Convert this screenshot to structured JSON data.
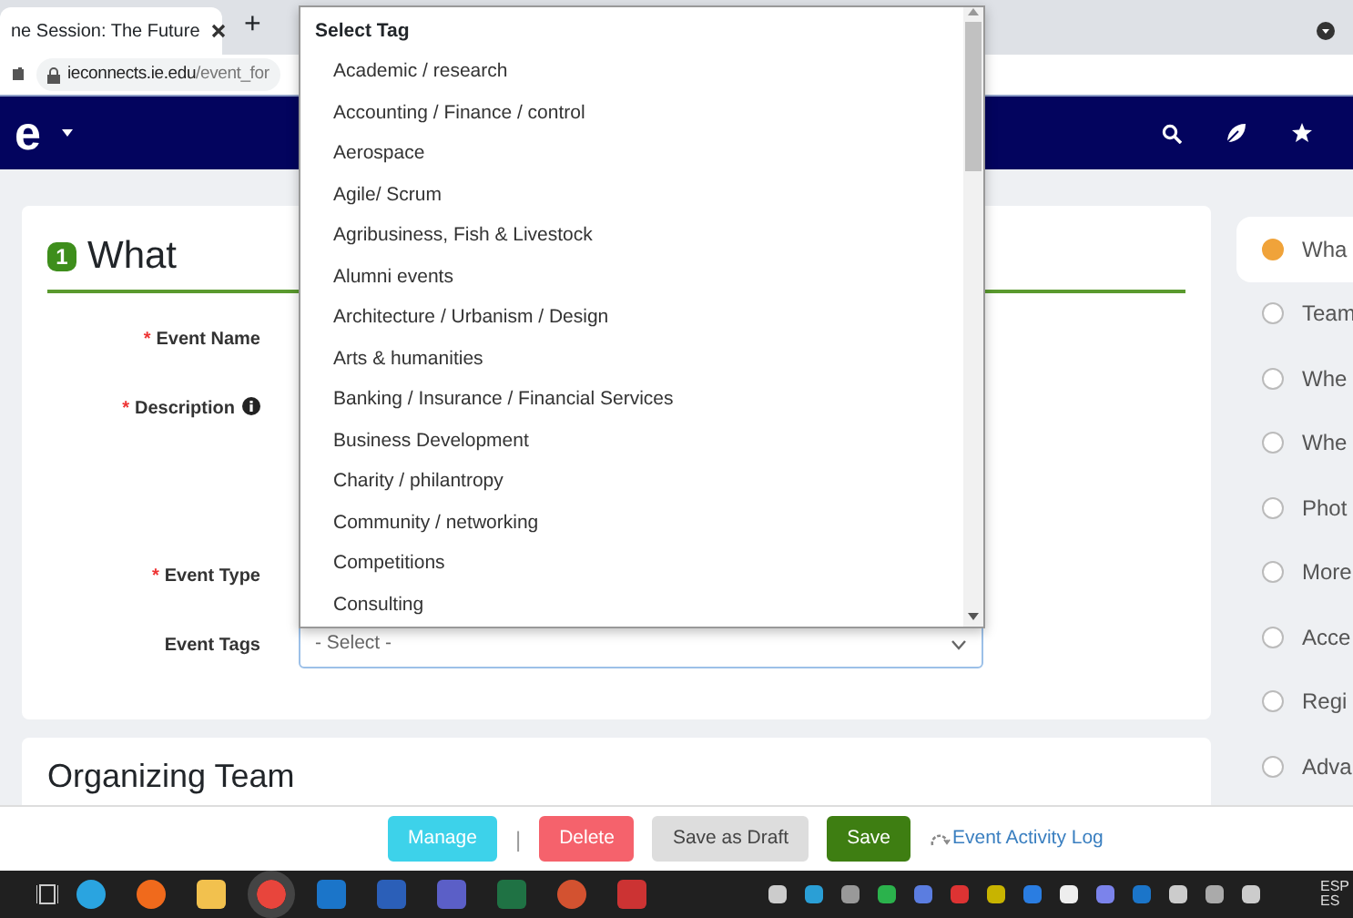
{
  "browser": {
    "tab_title": "ne Session: The Future",
    "new_tab": "+",
    "url_host": "ieconnects.ie.edu",
    "url_path": "/event_for"
  },
  "navbar": {
    "logo": "e"
  },
  "section": {
    "number": "1",
    "title": "What"
  },
  "fields": [
    {
      "label": "Event Name",
      "required_mark": "*",
      "kind": "input",
      "info": false
    },
    {
      "label": "Description",
      "required_mark": "*",
      "kind": "textarea",
      "info": true
    },
    {
      "label": "Event Type",
      "required_mark": "*",
      "kind": "input",
      "info": false
    },
    {
      "label": "Event Tags",
      "kind": "select",
      "value": "- Select -"
    }
  ],
  "tag_dropdown": {
    "header": "Select Tag",
    "options": [
      "Academic / research",
      "Accounting / Finance / control",
      "Aerospace",
      "Agile/ Scrum",
      "Agribusiness, Fish & Livestock",
      "Alumni events",
      "Architecture / Urbanism / Design",
      "Arts & humanities",
      "Banking / Insurance / Financial Services",
      "Business Development",
      "Charity / philantropy",
      "Community / networking",
      "Competitions",
      "Consulting"
    ]
  },
  "next_section": {
    "title": "Organizing Team"
  },
  "steps": [
    {
      "label": "Wha",
      "selected": true
    },
    {
      "label": "Team",
      "selected": false
    },
    {
      "label": "Whe",
      "selected": false
    },
    {
      "label": "Whe",
      "selected": false
    },
    {
      "label": "Phot",
      "selected": false
    },
    {
      "label": "More",
      "selected": false
    },
    {
      "label": "Acce",
      "selected": false
    },
    {
      "label": "Regi",
      "selected": false
    },
    {
      "label": "Adva",
      "selected": false
    }
  ],
  "actions": [
    {
      "label": "Manage",
      "kind": "info"
    },
    {
      "label": "|",
      "kind": "separator"
    },
    {
      "label": "Delete",
      "kind": "danger"
    },
    {
      "label": "Save as Draft",
      "kind": "secondary"
    },
    {
      "label": "Save",
      "kind": "success"
    },
    {
      "label": "Event Activity Log",
      "kind": "link"
    }
  ],
  "tray": {
    "lang_top": "ESP",
    "lang_bottom": "ES"
  }
}
